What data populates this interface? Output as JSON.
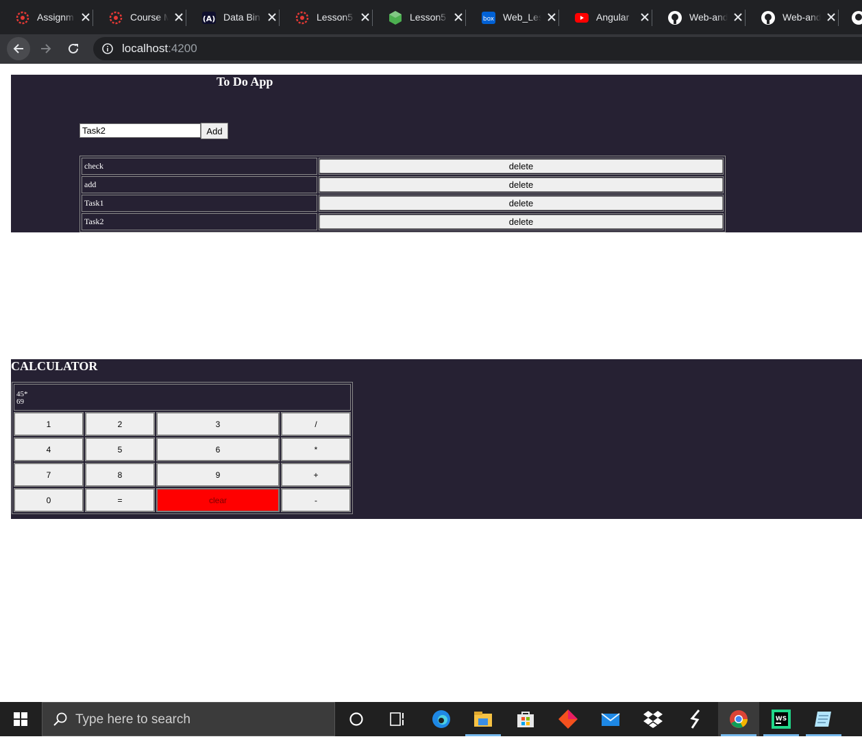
{
  "browser": {
    "tabs": [
      {
        "title": "Assignm",
        "icon": "canvas-icon"
      },
      {
        "title": "Course M",
        "icon": "canvas-icon"
      },
      {
        "title": "Data Bin",
        "icon": "angular-docs-icon"
      },
      {
        "title": "Lesson5",
        "icon": "canvas-icon"
      },
      {
        "title": "Lesson5",
        "icon": "cube-icon"
      },
      {
        "title": "Web_Les",
        "icon": "box-icon"
      },
      {
        "title": "Angular",
        "icon": "youtube-icon"
      },
      {
        "title": "Web-and",
        "icon": "github-icon"
      },
      {
        "title": "Web-and",
        "icon": "github-icon"
      }
    ],
    "url_host": "localhost",
    "url_port": ":4200"
  },
  "todo": {
    "title": "To Do App",
    "input_value": "Task2",
    "add_label": "Add",
    "tasks": [
      "check",
      "add",
      "Task1",
      "Task2"
    ],
    "delete_label": "delete"
  },
  "calculator": {
    "title": "CALCULATOR",
    "display_line1": "45*",
    "display_line2": "69",
    "rows": [
      [
        "1",
        "2",
        "3",
        "/"
      ],
      [
        "4",
        "5",
        "6",
        "*"
      ],
      [
        "7",
        "8",
        "9",
        "+"
      ],
      [
        "0",
        "=",
        "clear",
        "-"
      ]
    ],
    "clear_color": "#ff0000"
  },
  "taskbar": {
    "search_placeholder": "Type here to search",
    "apps": [
      "cortana-icon",
      "task-view-icon",
      "edge-icon",
      "file-explorer-icon",
      "store-icon",
      "git-kraken-icon",
      "mail-icon",
      "dropbox-icon",
      "sublime-icon",
      "chrome-icon",
      "webstorm-icon",
      "notepad-icon"
    ]
  }
}
